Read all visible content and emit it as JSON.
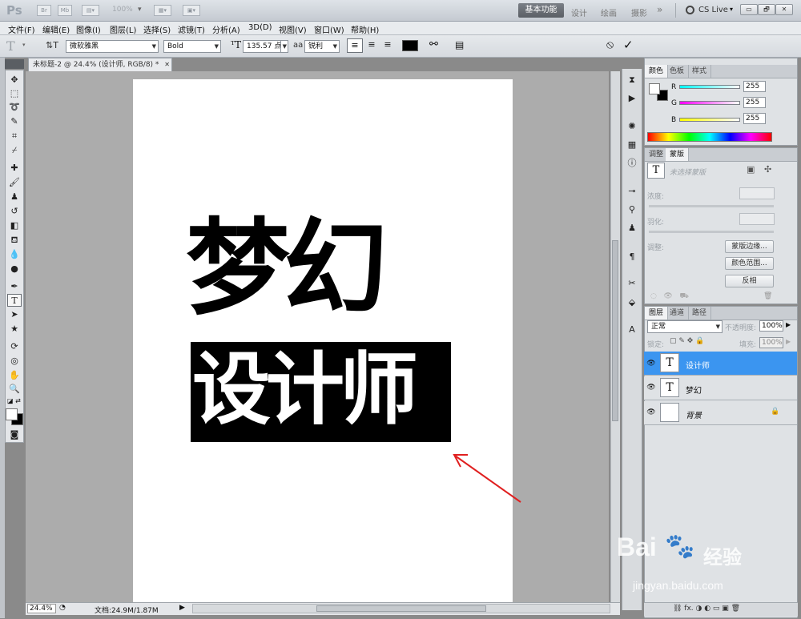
{
  "app": {
    "logo": "Ps",
    "zoom_dropdown": "100%",
    "workspaces": [
      "基本功能",
      "设计",
      "绘画",
      "摄影"
    ],
    "more": "»",
    "cslive": "CS Live",
    "win_buttons": [
      "▭",
      "🗗",
      "✕"
    ]
  },
  "menu": [
    "文件(F)",
    "编辑(E)",
    "图像(I)",
    "图层(L)",
    "选择(S)",
    "滤镜(T)",
    "分析(A)",
    "3D(D)",
    "视图(V)",
    "窗口(W)",
    "帮助(H)"
  ],
  "options": {
    "font_family": "微软雅黑",
    "font_style": "Bold",
    "font_size": "135.57 点",
    "antialias_label": "aa",
    "antialias": "锐利",
    "text_color": "#000000",
    "cancel_icon": "⦸",
    "commit_icon": "✓"
  },
  "document": {
    "tab_title": "未标题-2 @ 24.4% (设计师, RGB/8) *",
    "zoom": "24.4%",
    "info": "文档:24.9M/1.87M",
    "text_line1": "梦幻",
    "text_line2": "设计师"
  },
  "color_panel": {
    "tabs": [
      "颜色",
      "色板",
      "样式"
    ],
    "channels": [
      {
        "label": "R",
        "value": "255"
      },
      {
        "label": "G",
        "value": "255"
      },
      {
        "label": "B",
        "value": "255"
      }
    ]
  },
  "adjust_panel": {
    "tabs": [
      "调整",
      "蒙版"
    ],
    "mask_hint": "未选择蒙版",
    "density_label": "浓度:",
    "feather_label": "羽化:",
    "refine_label": "调整:",
    "buttons": [
      "蒙版边缘...",
      "颜色范围...",
      "反相"
    ]
  },
  "layers_panel": {
    "tabs": [
      "图层",
      "通道",
      "路径"
    ],
    "blend_mode": "正常",
    "opacity_label": "不透明度:",
    "opacity": "100%",
    "lock_label": "锁定:",
    "fill_label": "填充:",
    "fill": "100%",
    "layers": [
      {
        "name": "设计师",
        "thumb": "T",
        "selected": true
      },
      {
        "name": "梦幻",
        "thumb": "T",
        "selected": false
      },
      {
        "name": "背景",
        "thumb": "",
        "selected": false
      }
    ]
  },
  "watermark": {
    "brand": "Bai",
    "brand2": "经验",
    "url": "jingyan.baidu.com"
  }
}
